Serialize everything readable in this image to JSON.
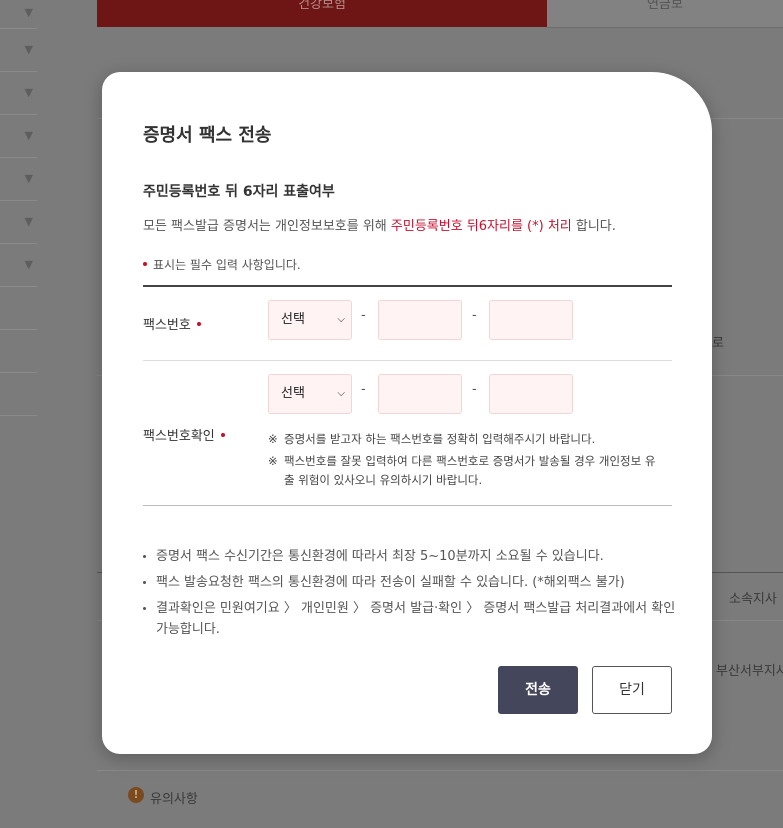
{
  "background": {
    "tab_active": "건강보험",
    "tab_other": "연금보",
    "right_text_1": "로",
    "right_text_2": "소속지사",
    "right_text_3": "부산서부지사",
    "notice_label": "유의사항",
    "notice_icon": "warning-icon"
  },
  "modal": {
    "title": "증명서 팩스 전송",
    "section_title": "주민등록번호 뒤 6자리 표출여부",
    "desc_before": "모든 팩스발급 증명서는 개인정보보호를 위해 ",
    "desc_highlight": "주민등록번호 뒤6자리를 (*) 처리",
    "desc_after": " 합니다.",
    "required_note": "표시는 필수 입력 사항입니다.",
    "fax_label": "팩스번호",
    "fax_confirm_label": "팩스번호확인",
    "select_value": "선택",
    "dash": "-",
    "notes": [
      "증명서를 받고자 하는 팩스번호를 정확히 입력해주시기 바랍니다.",
      "팩스번호를 잘못 입력하여 다른 팩스번호로 증명서가 발송될 경우 개인정보 유출 위험이 있사오니 유의하시기 바랍니다."
    ],
    "note_mark": "※",
    "bullets": [
      "증명서 팩스 수신기간은 통신환경에 따라서 최장 5~10분까지 소요될 수 있습니다.",
      "팩스 발송요청한 팩스의 통신환경에 따라 전송이 실패할 수 있습니다. (*해외팩스 불가)",
      "결과확인은 민원여기요 〉 개인민원 〉 증명서 발급·확인 〉 증명서 팩스발급 처리결과에서 확인 가능합니다."
    ],
    "send_button": "전송",
    "close_button": "닫기"
  },
  "colors": {
    "accent_red": "#c8102e",
    "button_dark": "#44465b",
    "input_bg": "#fff3f3"
  }
}
